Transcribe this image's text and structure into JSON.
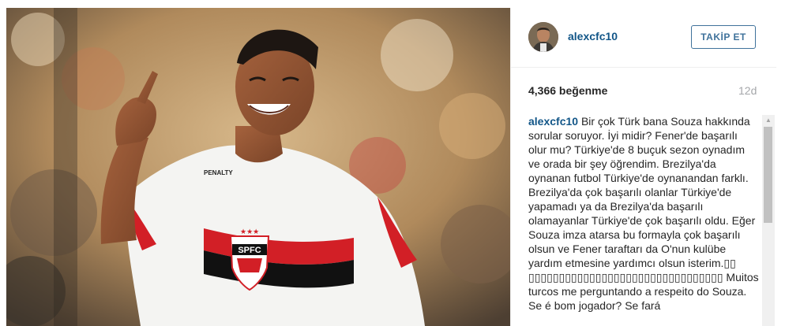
{
  "post": {
    "username": "alexcfc10",
    "follow_label": "TAKİP ET",
    "likes": "4,366 beğenme",
    "time_ago": "12d",
    "caption_user": "alexcfc10",
    "caption_text": " Bir çok Türk bana Souza hakkında sorular soruyor. İyi midir? Fener'de başarılı olur mu? Türkiye'de 8 buçuk sezon oynadım ve orada bir şey öğrendim. Brezilya'da oynanan futbol Türkiye'de oynanandan farklı. Brezilya'da çok başarılı olanlar Türkiye'de yapamadı ya da Brezilya'da başarılı olamayanlar Türkiye'de çok başarılı oldu. Eğer Souza imza atarsa bu formayla çok başarılı olsun ve Fener taraftarı da O'nun kulübe yardım etmesine yardımcı olsun isterim.▯▯ ▯▯▯▯▯▯▯▯▯▯▯▯▯▯▯▯▯▯▯▯▯▯▯▯▯▯▯▯▯▯▯▯ Muitos turcos me perguntando a respeito do Souza. Se é bom jogador? Se fará"
  },
  "photo": {
    "crest_text": "SPFC",
    "jersey_brand": "PENALTY"
  },
  "icons": {
    "scroll_up": "scroll-up-arrow-icon"
  },
  "colors": {
    "link_blue": "#125688",
    "button_blue": "#3f729b",
    "text": "#262626",
    "muted": "#a5a7aa",
    "jersey_red": "#d21f26"
  }
}
